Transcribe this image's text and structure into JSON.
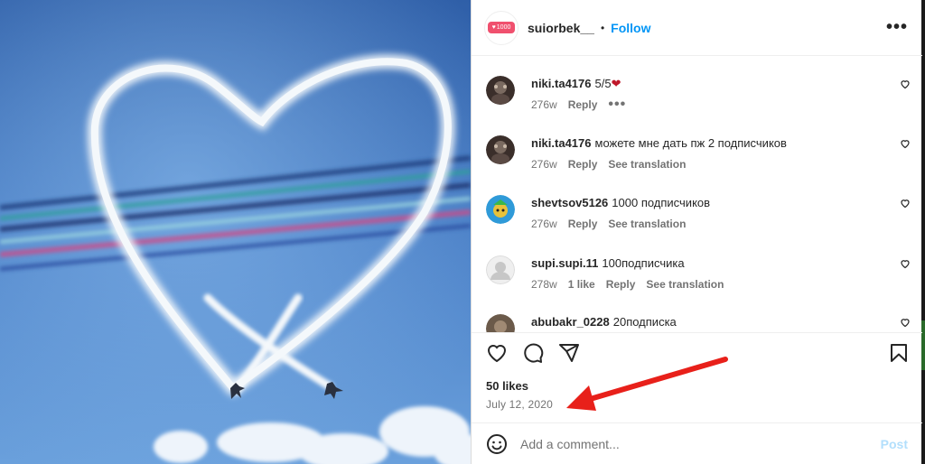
{
  "header": {
    "logo_text": "1000",
    "username": "suiorbek__",
    "separator": "•",
    "follow_label": "Follow",
    "more_icon": "more-horizontal-icon"
  },
  "comments": [
    {
      "user": "niki.ta4176",
      "text": "5/5❤",
      "age": "276w",
      "likes": "",
      "reply": "Reply",
      "translate": "",
      "extra": "•••"
    },
    {
      "user": "niki.ta4176",
      "text": "можете мне дать пж 2 подписчиков",
      "age": "276w",
      "likes": "",
      "reply": "Reply",
      "translate": "See translation",
      "extra": ""
    },
    {
      "user": "shevtsov5126",
      "text": "1000 подписчиков",
      "age": "276w",
      "likes": "",
      "reply": "Reply",
      "translate": "See translation",
      "extra": ""
    },
    {
      "user": "supi.supi.11",
      "text": "100подписчика",
      "age": "278w",
      "likes": "1 like",
      "reply": "Reply",
      "translate": "See translation",
      "extra": ""
    },
    {
      "user": "abubakr_0228",
      "text": "20подписка",
      "age": "",
      "likes": "",
      "reply": "",
      "translate": "",
      "extra": ""
    }
  ],
  "post": {
    "likes": "50 likes",
    "date": "July 12, 2020"
  },
  "composer": {
    "placeholder": "Add a comment...",
    "post_label": "Post"
  },
  "colors": {
    "accent": "#0095f6",
    "post_disabled": "#b2dffc",
    "annotation_arrow": "#e8201a",
    "text_secondary": "#737373"
  }
}
